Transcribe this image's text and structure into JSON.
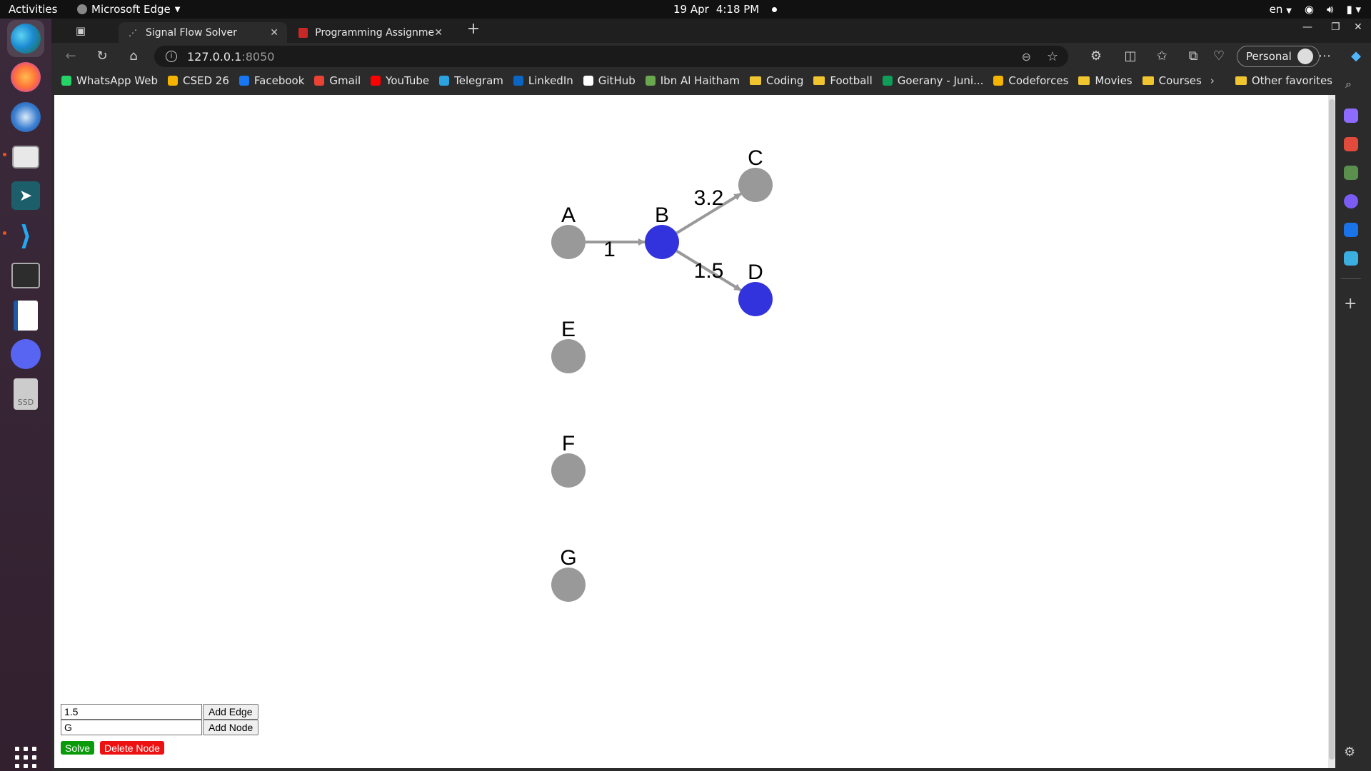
{
  "system": {
    "activities": "Activities",
    "app_name": "Microsoft Edge",
    "date": "19 Apr",
    "time": "4:18 PM",
    "lang": "en"
  },
  "dock": {
    "items": [
      "edge-icon",
      "firefox-icon",
      "thunderbird-icon",
      "files-icon",
      "store-icon",
      "vscode-icon",
      "terminal-icon",
      "writer-icon",
      "discord-icon",
      "ssd-icon"
    ],
    "ssd_label": "SSD"
  },
  "tabs": [
    {
      "title": "Signal Flow Solver",
      "active": true
    },
    {
      "title": "Programming Assignmen",
      "active": false
    }
  ],
  "address": {
    "host": "127.0.0.1",
    "port": ":8050"
  },
  "profile": {
    "label": "Personal"
  },
  "bookmarks": [
    {
      "label": "WhatsApp Web",
      "color": "#25d366"
    },
    {
      "label": "CSED 26",
      "color": "#f4b400"
    },
    {
      "label": "Facebook",
      "color": "#1877f2"
    },
    {
      "label": "Gmail",
      "color": "#ea4335"
    },
    {
      "label": "YouTube",
      "color": "#ff0000"
    },
    {
      "label": "Telegram",
      "color": "#2aa3e0"
    },
    {
      "label": "LinkedIn",
      "color": "#0a66c2"
    },
    {
      "label": "GitHub",
      "color": "#ffffff"
    },
    {
      "label": "Ibn Al Haitham",
      "color": "#6aa84f"
    },
    {
      "label": "Coding",
      "folder": true
    },
    {
      "label": "Football",
      "folder": true
    },
    {
      "label": "Goerany - Juni...",
      "color": "#0f9d58"
    },
    {
      "label": "Codeforces",
      "color": "#f4b400"
    },
    {
      "label": "Movies",
      "folder": true
    },
    {
      "label": "Courses",
      "folder": true
    }
  ],
  "other_favorites": "Other favorites",
  "graph": {
    "nodes": [
      {
        "id": "A",
        "color": "#999999"
      },
      {
        "id": "B",
        "color": "#3333dd"
      },
      {
        "id": "C",
        "color": "#999999"
      },
      {
        "id": "D",
        "color": "#3333dd"
      },
      {
        "id": "E",
        "color": "#999999"
      },
      {
        "id": "F",
        "color": "#999999"
      },
      {
        "id": "G",
        "color": "#999999"
      }
    ],
    "edges": [
      {
        "from": "A",
        "to": "B",
        "weight": "1"
      },
      {
        "from": "B",
        "to": "C",
        "weight": "3.2"
      },
      {
        "from": "B",
        "to": "D",
        "weight": "1.5"
      }
    ],
    "edge_color": "#999999"
  },
  "form": {
    "edge_input_value": "1.5",
    "add_edge_label": "Add Edge",
    "node_input_value": "G",
    "add_node_label": "Add Node",
    "solve_label": "Solve",
    "delete_label": "Delete Node"
  }
}
